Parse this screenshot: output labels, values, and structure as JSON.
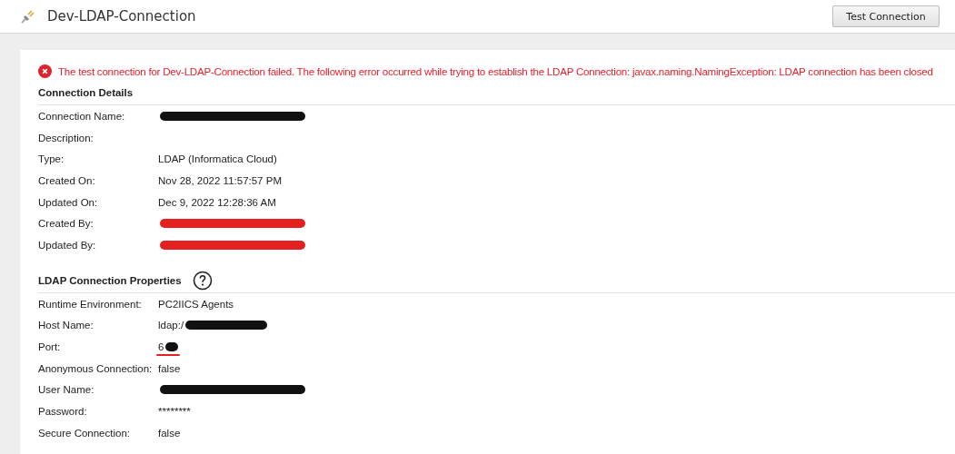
{
  "header": {
    "title": "Dev-LDAP-Connection",
    "button": "Test Connection"
  },
  "error": {
    "message": "The test connection for Dev-LDAP-Connection failed. The following error occurred while trying to establish the LDAP Connection: javax.naming.NamingException: LDAP connection has been closed"
  },
  "sections": [
    {
      "title": "Connection Details",
      "help": false,
      "rows": [
        {
          "label": "Connection Name:",
          "redacted": true,
          "color": "#111111"
        },
        {
          "label": "Description:"
        },
        {
          "label": "Type:",
          "value": "LDAP (Informatica Cloud)"
        },
        {
          "label": "Created On:",
          "value": "Nov 28, 2022 11:57:57 PM"
        },
        {
          "label": "Updated On:",
          "value": "Dec 9, 2022 12:28:36 AM"
        },
        {
          "label": "Created By:",
          "redacted": true,
          "color": "#e52020"
        },
        {
          "label": "Updated By:",
          "redacted": true,
          "color": "#e52020"
        }
      ]
    },
    {
      "title": "LDAP Connection Properties",
      "help": true,
      "rows": [
        {
          "label": "Runtime Environment:",
          "value": "PC2IICS Agents"
        },
        {
          "label": "Host Name:",
          "value": "ldap:/",
          "redacted": true,
          "color": "#111111"
        },
        {
          "label": "Port:",
          "value": "6",
          "redacted": true,
          "color": "#111111",
          "underlined": true
        },
        {
          "label": "Anonymous Connection:",
          "value": "false"
        },
        {
          "label": "User Name:",
          "redacted": true,
          "color": "#111111"
        },
        {
          "label": "Password:",
          "value": "********"
        },
        {
          "label": "Secure Connection:",
          "value": "false"
        }
      ]
    }
  ]
}
